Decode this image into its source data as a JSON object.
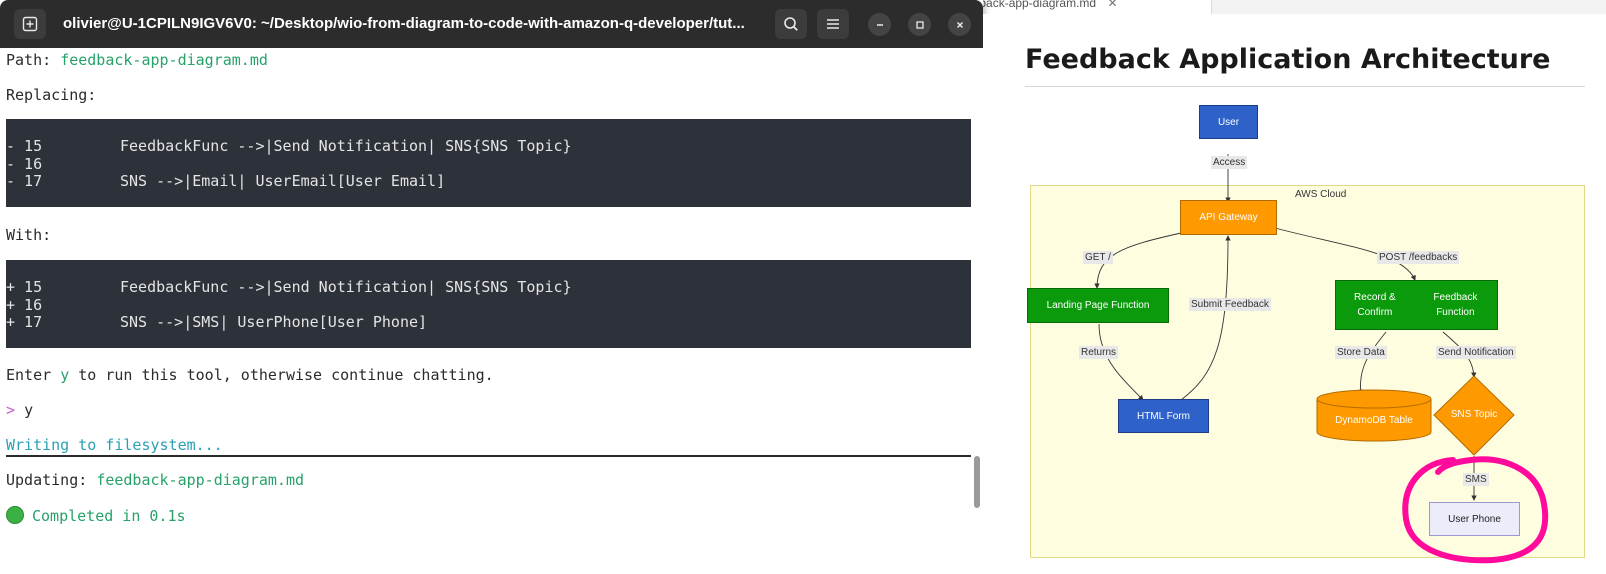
{
  "background_editor": {
    "tab_label": "Preview feedback-app-diagram.md"
  },
  "terminal": {
    "title": "olivier@U-1CPILN9IGV6V0: ~/Desktop/wio-from-diagram-to-code-with-amazon-q-developer/tut...",
    "icons": {
      "new_tab": "new-tab-icon",
      "search": "search-icon",
      "menu": "hamburger-menu-icon",
      "minimize": "minimize-icon",
      "maximize": "maximize-icon",
      "close": "close-icon"
    },
    "path_label": "Path: ",
    "path_value": "feedback-app-diagram.md",
    "replacing_label": "Replacing:",
    "old_lines": [
      {
        "num": "- 15",
        "text": "FeedbackFunc -->|Send Notification| SNS{SNS Topic}"
      },
      {
        "num": "- 16",
        "text": ""
      },
      {
        "num": "- 17",
        "text": "SNS -->|Email| UserEmail[User Email]"
      }
    ],
    "with_label": "With:",
    "new_lines": [
      {
        "num": "+ 15",
        "text": "FeedbackFunc -->|Send Notification| SNS{SNS Topic}"
      },
      {
        "num": "+ 16",
        "text": ""
      },
      {
        "num": "+ 17",
        "text": "SNS -->|SMS| UserPhone[User Phone]"
      }
    ],
    "enter_prefix": "Enter ",
    "enter_key": "y",
    "enter_suffix": " to run this tool, otherwise continue chatting.",
    "prompt_symbol": ">",
    "prompt_input": "y",
    "writing": "Writing to filesystem...",
    "updating_label": "Updating: ",
    "updating_value": "feedback-app-diagram.md",
    "completed": "Completed in 0.1s"
  },
  "preview": {
    "title": "Feedback Application Architecture",
    "aws_label": "AWS Cloud",
    "nodes": {
      "user": "User",
      "api_gateway": "API Gateway",
      "landing": "Landing Page Function",
      "record_line1": "Record & Confirm",
      "record_line2": "Feedback Function",
      "html_form": "HTML Form",
      "dynamodb": "DynamoDB Table",
      "sns": "SNS Topic",
      "user_phone": "User Phone"
    },
    "edges": {
      "access": "Access",
      "get": "GET /",
      "post": "POST /feedbacks",
      "submit": "Submit Feedback",
      "returns": "Returns",
      "store": "Store Data",
      "send": "Send Notification",
      "sms": "SMS"
    },
    "colors": {
      "highlight": "#ff0a9a",
      "aws_bg": "#fffde0",
      "blue": "#2f62c8",
      "orange": "#ff9900",
      "green": "#0b9a0b"
    }
  }
}
